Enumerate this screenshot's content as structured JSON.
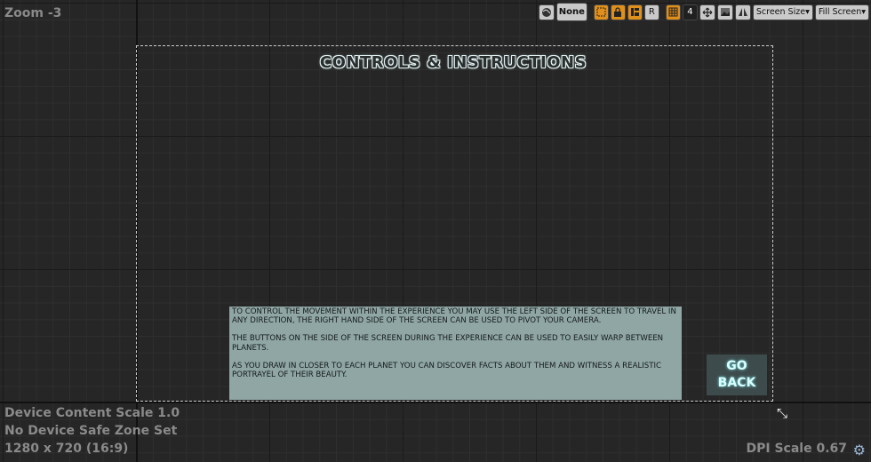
{
  "viewport": {
    "zoom": "Zoom -3",
    "device_content_scale": "Device Content Scale 1.0",
    "safe_zone": "No Device Safe Zone Set",
    "resolution": "1280 x 720 (16:9)",
    "dpi_scale": "DPI Scale 0.67"
  },
  "toolbar": {
    "dropdown_none": "None",
    "respect_locks_label": "R",
    "grid_snap_value": "4",
    "screen_size": "Screen Size",
    "fill_screen": "Fill Screen"
  },
  "widget": {
    "title": "CONTROLS & INSTRUCTIONS",
    "paragraphs": [
      "TO CONTROL THE MOVEMENT WITHIN THE EXPERIENCE YOU MAY USE THE LEFT SIDE OF THE SCREEN TO TRAVEL IN ANY DIRECTION, THE RIGHT HAND SIDE OF THE SCREEN CAN BE USED TO PIVOT YOUR CAMERA.",
      "THE BUTTONS ON THE SIDE OF THE SCREEN DURING THE EXPERIENCE CAN BE USED TO EASILY WARP BETWEEN PLANETS.",
      "AS YOU DRAW IN CLOSER TO EACH PLANET YOU CAN DISCOVER FACTS ABOUT THEM AND WITNESS A REALISTIC PORTRAYEL OF THEIR BEAUTY."
    ],
    "go_back_line1": "GO",
    "go_back_line2": "BACK"
  },
  "icons": {
    "settings": "gear-icon",
    "resize": "resize-icon",
    "globe": "globe-icon",
    "lock": "lock-icon"
  },
  "colors": {
    "background": "#262626",
    "accent": "#e08f1b",
    "text_panel": "#8fa6a5",
    "button": "#3e4b4c"
  }
}
